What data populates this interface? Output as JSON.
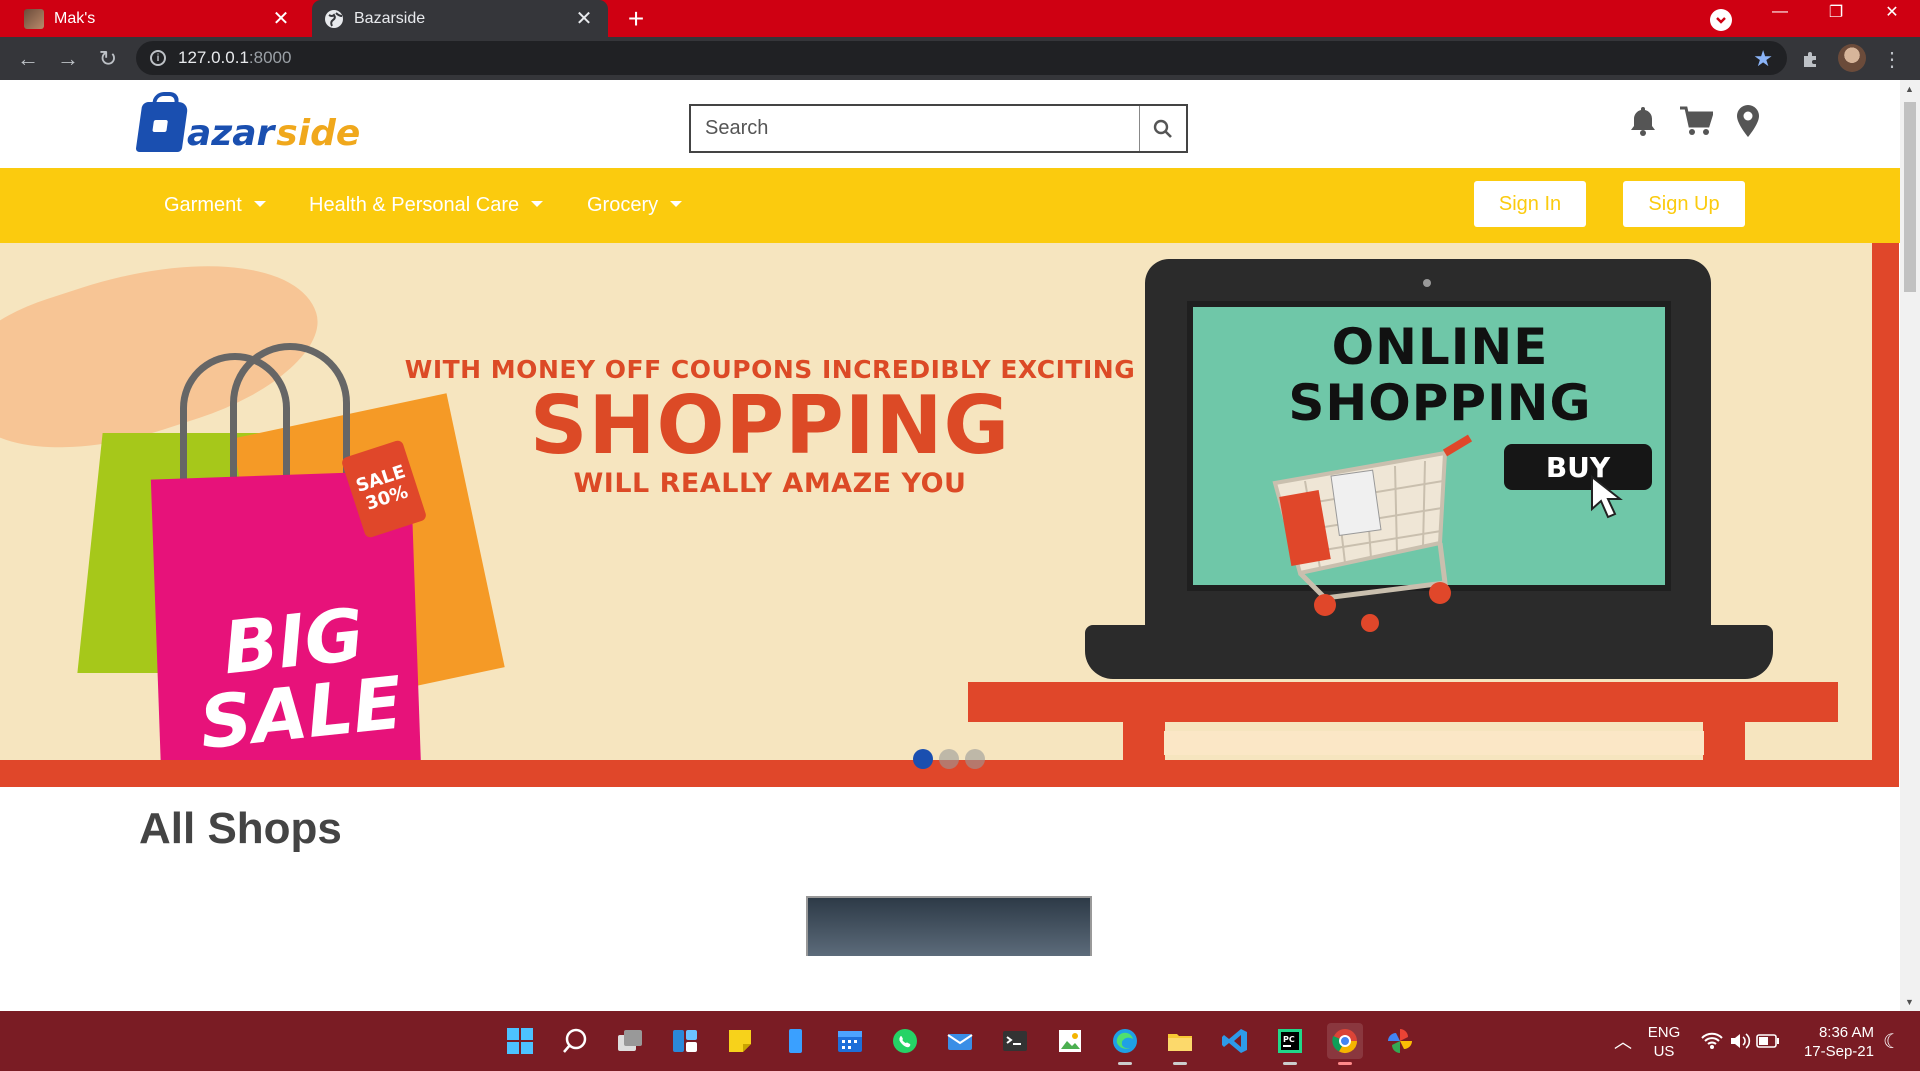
{
  "browser": {
    "tabs": [
      {
        "title": "Mak's",
        "active": false
      },
      {
        "title": "Bazarside",
        "active": true
      }
    ],
    "url_host": "127.0.0.1",
    "url_port": ":8000"
  },
  "site": {
    "logo_letter": "B",
    "logo_part1": "azar",
    "logo_part2": "side",
    "search_placeholder": "Search",
    "nav": [
      {
        "label": "Garment"
      },
      {
        "label": "Health & Personal Care"
      },
      {
        "label": "Grocery"
      }
    ],
    "sign_in": "Sign In",
    "sign_up": "Sign Up",
    "colors": {
      "nav_bg": "#fbcb0e",
      "brand_blue": "#1a4fb0",
      "brand_orange": "#f0a81c",
      "banner_red": "#e0472a"
    }
  },
  "banner": {
    "tagline_top": "WITH MONEY OFF COUPONS INCREDIBLY EXCITING",
    "tagline_main": "SHOPPING",
    "tagline_bottom": "WILL REALLY AMAZE YOU",
    "bag_text_1": "BIG",
    "bag_text_2": "SALE",
    "sale_tag_1": "SALE",
    "sale_tag_2": "30%",
    "screen_title_1": "ONLINE",
    "screen_title_2": "SHOPPING",
    "buy_label": "BUY",
    "slides": 3,
    "active_slide": 1
  },
  "main": {
    "section_title": "All Shops"
  },
  "taskbar": {
    "lang_1": "ENG",
    "lang_2": "US",
    "time": "8:36 AM",
    "date": "17-Sep-21"
  }
}
